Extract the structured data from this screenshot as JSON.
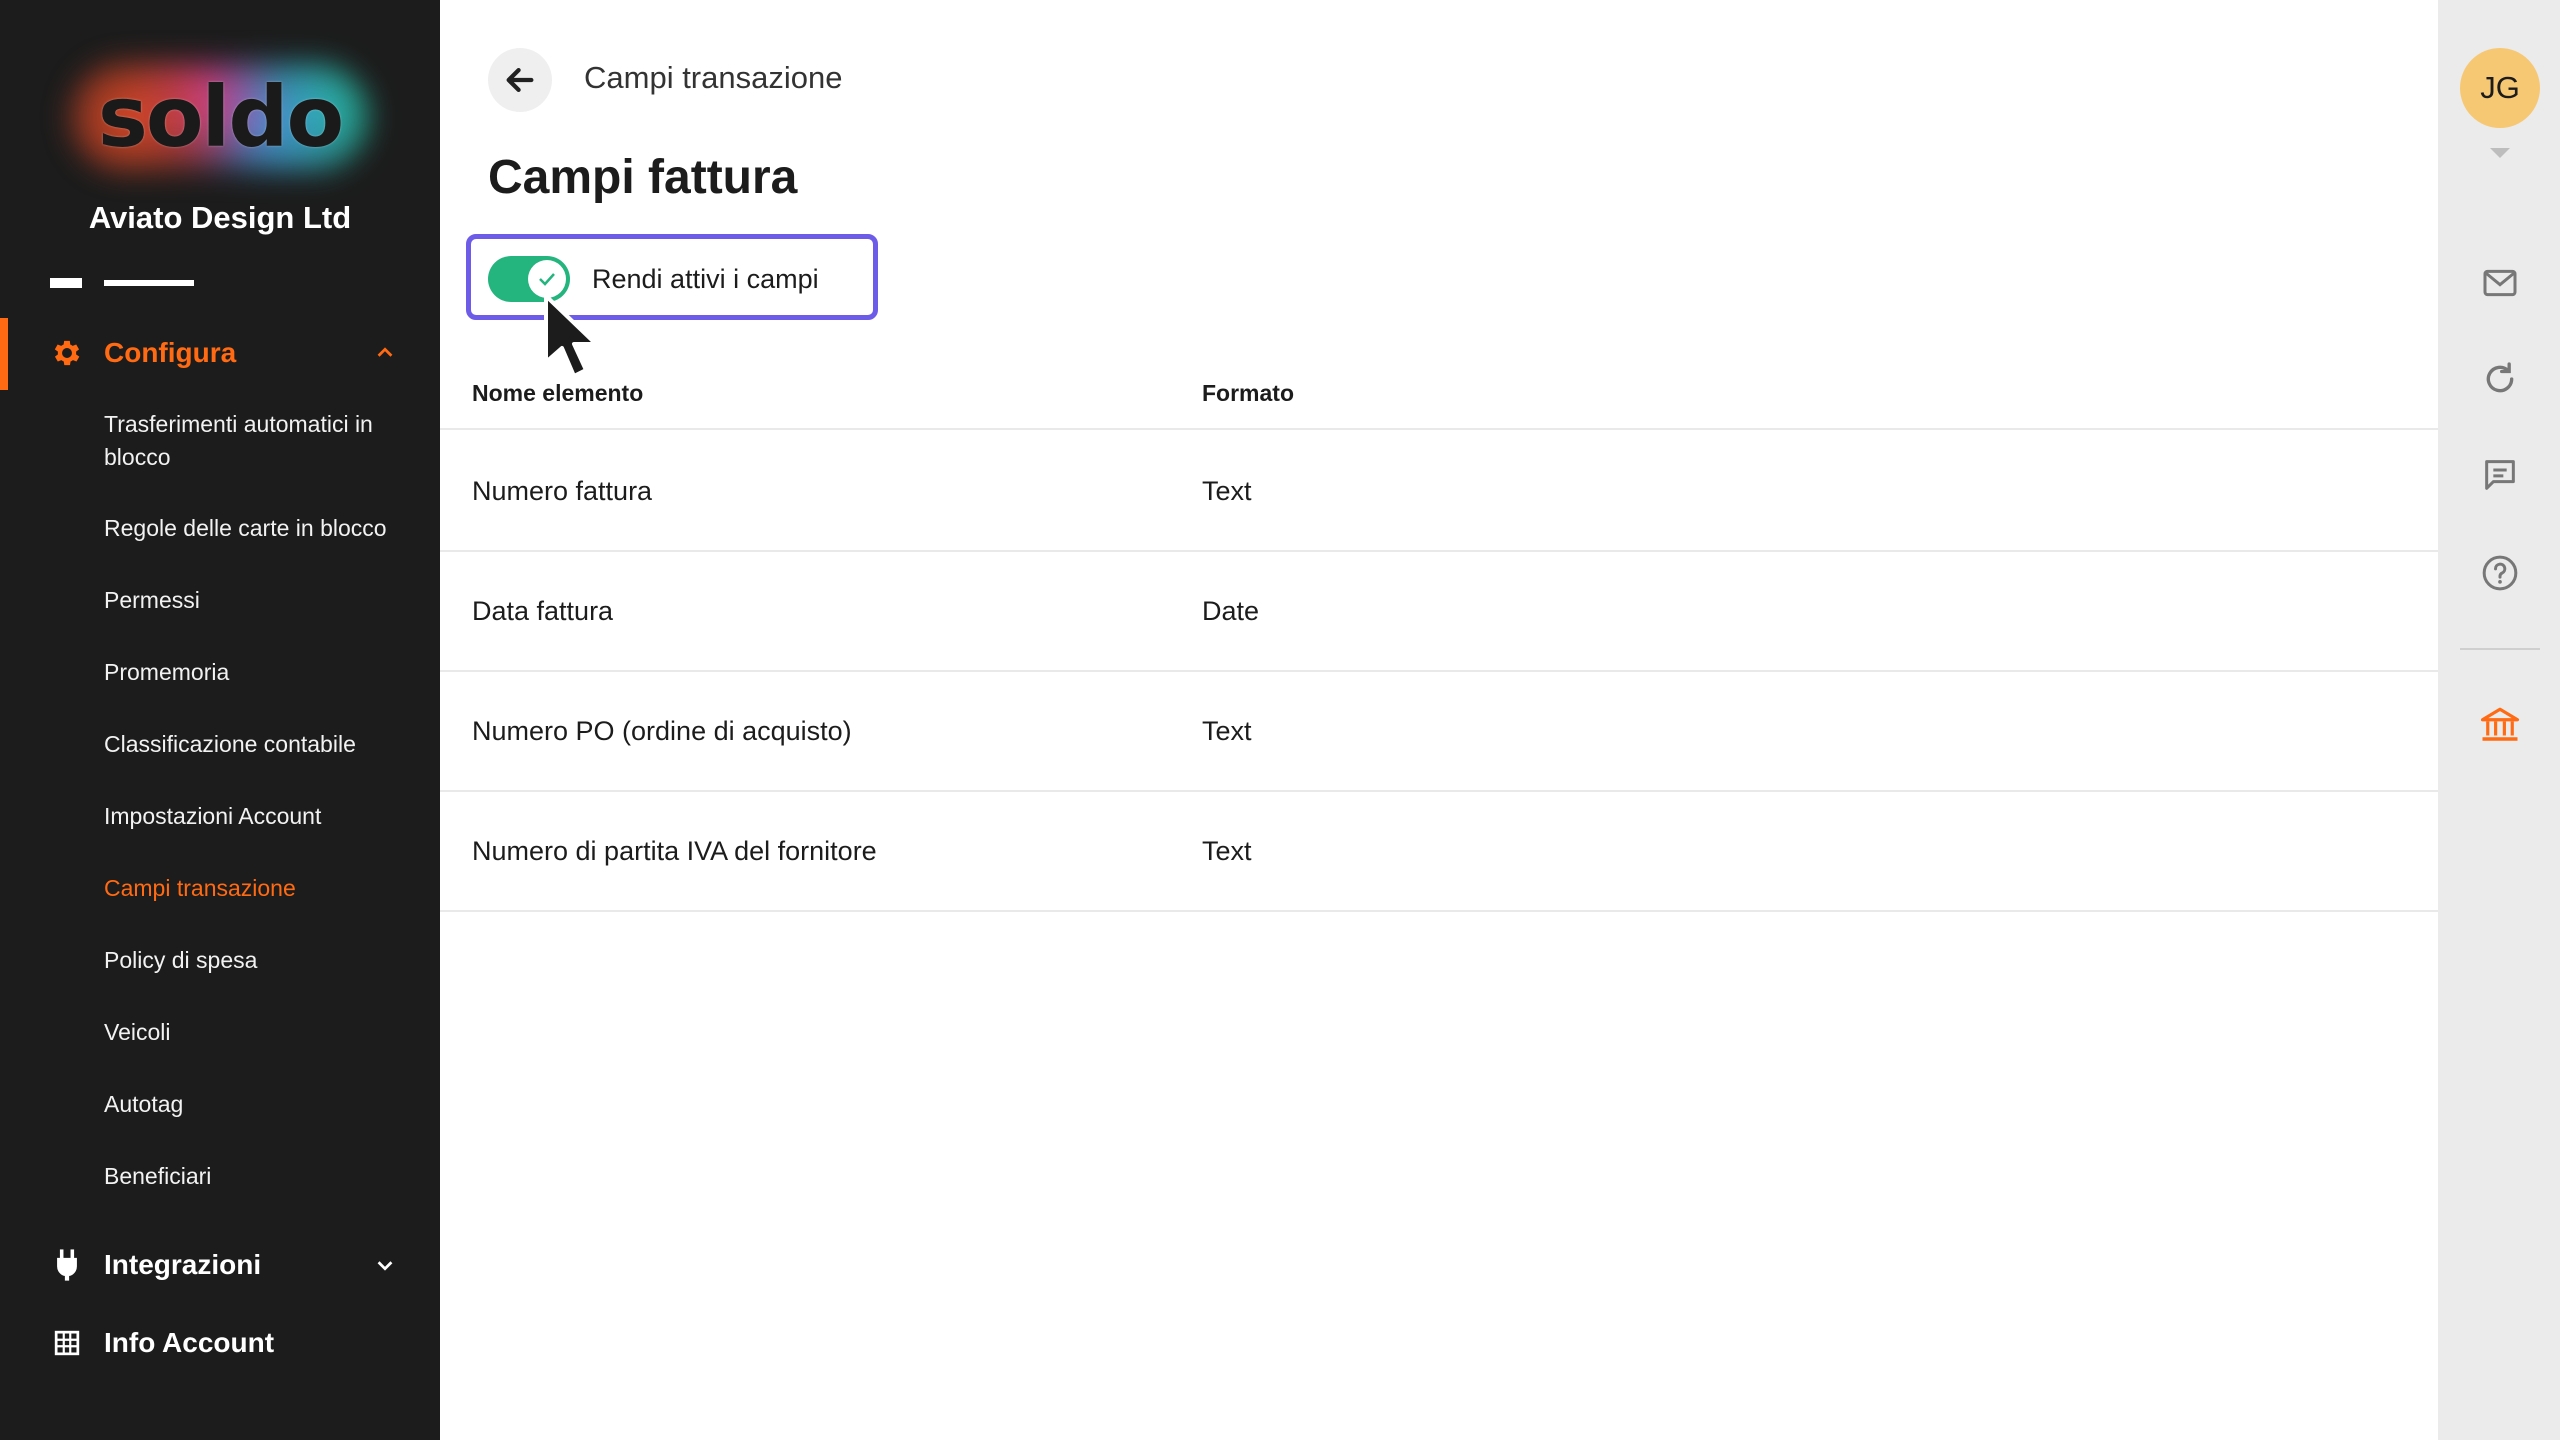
{
  "brand": {
    "logo_text": "soldo",
    "company": "Aviato Design Ltd"
  },
  "sidebar": {
    "sections": {
      "configura": "Configura",
      "integrazioni": "Integrazioni",
      "info_account": "Info Account"
    },
    "configura_items": [
      "Trasferimenti automatici in blocco",
      "Regole delle carte in blocco",
      "Permessi",
      "Promemoria",
      "Classificazione contabile",
      "Impostazioni Account",
      "Campi transazione",
      "Policy di spesa",
      "Veicoli",
      "Autotag",
      "Beneficiari"
    ],
    "active_item": "Campi transazione",
    "accent_color": "#ff6a13"
  },
  "header": {
    "breadcrumb": "Campi transazione",
    "title": "Campi fattura"
  },
  "toggle": {
    "label": "Rendi attivi i campi",
    "checked": true,
    "color": "#24b47e",
    "highlight_color": "#6c5ce7"
  },
  "table": {
    "headers": [
      "Nome elemento",
      "Formato"
    ],
    "rows": [
      {
        "name": "Numero fattura",
        "format": "Text"
      },
      {
        "name": "Data fattura",
        "format": "Date"
      },
      {
        "name": "Numero PO (ordine di acquisto)",
        "format": "Text"
      },
      {
        "name": "Numero di partita IVA del fornitore",
        "format": "Text"
      }
    ]
  },
  "rail": {
    "avatar_initials": "JG",
    "icons": [
      "mail-icon",
      "refresh-icon",
      "chat-icon",
      "help-icon",
      "bank-icon"
    ]
  }
}
